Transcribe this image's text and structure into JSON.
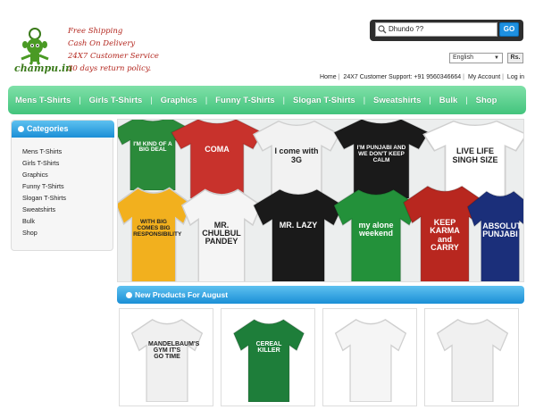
{
  "logo": {
    "text": "champu.in"
  },
  "promo": {
    "lines": [
      "Free Shipping",
      "Cash On Delivery",
      "24X7 Customer Service",
      "30 days return policy."
    ]
  },
  "search": {
    "value": "Dhundo ??",
    "button": "GO"
  },
  "currency": {
    "language": "English",
    "button": "Rs."
  },
  "toplinks": {
    "home": "Home",
    "support": "24X7 Customer Support: +91 9560346664",
    "account": "My Account",
    "login": "Log in"
  },
  "nav": {
    "items": [
      "Mens T-Shirts",
      "Girls T-Shirts",
      "Graphics",
      "Funny T-Shirts",
      "Slogan T-Shirts",
      "Sweatshirts",
      "Bulk",
      "Shop"
    ]
  },
  "sidebar": {
    "title": "Categories",
    "items": [
      "Mens T-Shirts",
      "Girls T-Shirts",
      "Graphics",
      "Funny T-Shirts",
      "Slogan T-Shirts",
      "Sweatshirts",
      "Bulk",
      "Shop"
    ]
  },
  "banner": {
    "tees": [
      {
        "text": "I'M KIND OF A BIG DEAL",
        "color": "#2a8a3a"
      },
      {
        "text": "COMA",
        "color": "#c8322c"
      },
      {
        "text": "I come with 3G",
        "color": "#f2f2f2"
      },
      {
        "text": "I'M PUNJABI AND WE DON'T KEEP CALM",
        "color": "#1a1a1a"
      },
      {
        "text": "LIVE LIFE SINGH SIZE",
        "color": "#ffffff"
      },
      {
        "text": "WITH BIG COMES BIG RESPONSIBILITY",
        "color": "#f2b01e"
      },
      {
        "text": "MR. CHULBUL PANDEY",
        "color": "#f5f5f5"
      },
      {
        "text": "MR. LAZY",
        "color": "#1a1a1a"
      },
      {
        "text": "my alone weekend",
        "color": "#23913a"
      },
      {
        "text": "KEEP KARMA and CARRY",
        "color": "#b8271f"
      },
      {
        "text": "ABSOLUT PUNJABI",
        "color": "#1b2f7a"
      }
    ]
  },
  "new_products": {
    "title": "New Products For August",
    "items": [
      {
        "text": "MANDELBAUM'S GYM IT'S GO TIME",
        "color": "#f0f0f0"
      },
      {
        "text": "CEREAL KILLER",
        "color": "#1e7e3a"
      },
      {
        "text": "",
        "color": "#f5f5f5"
      },
      {
        "text": "",
        "color": "#f0f0f0"
      }
    ]
  },
  "colors": {
    "nav": "#43c47d",
    "accent_blue": "#1b8fd6",
    "promo_red": "#b3261e"
  }
}
